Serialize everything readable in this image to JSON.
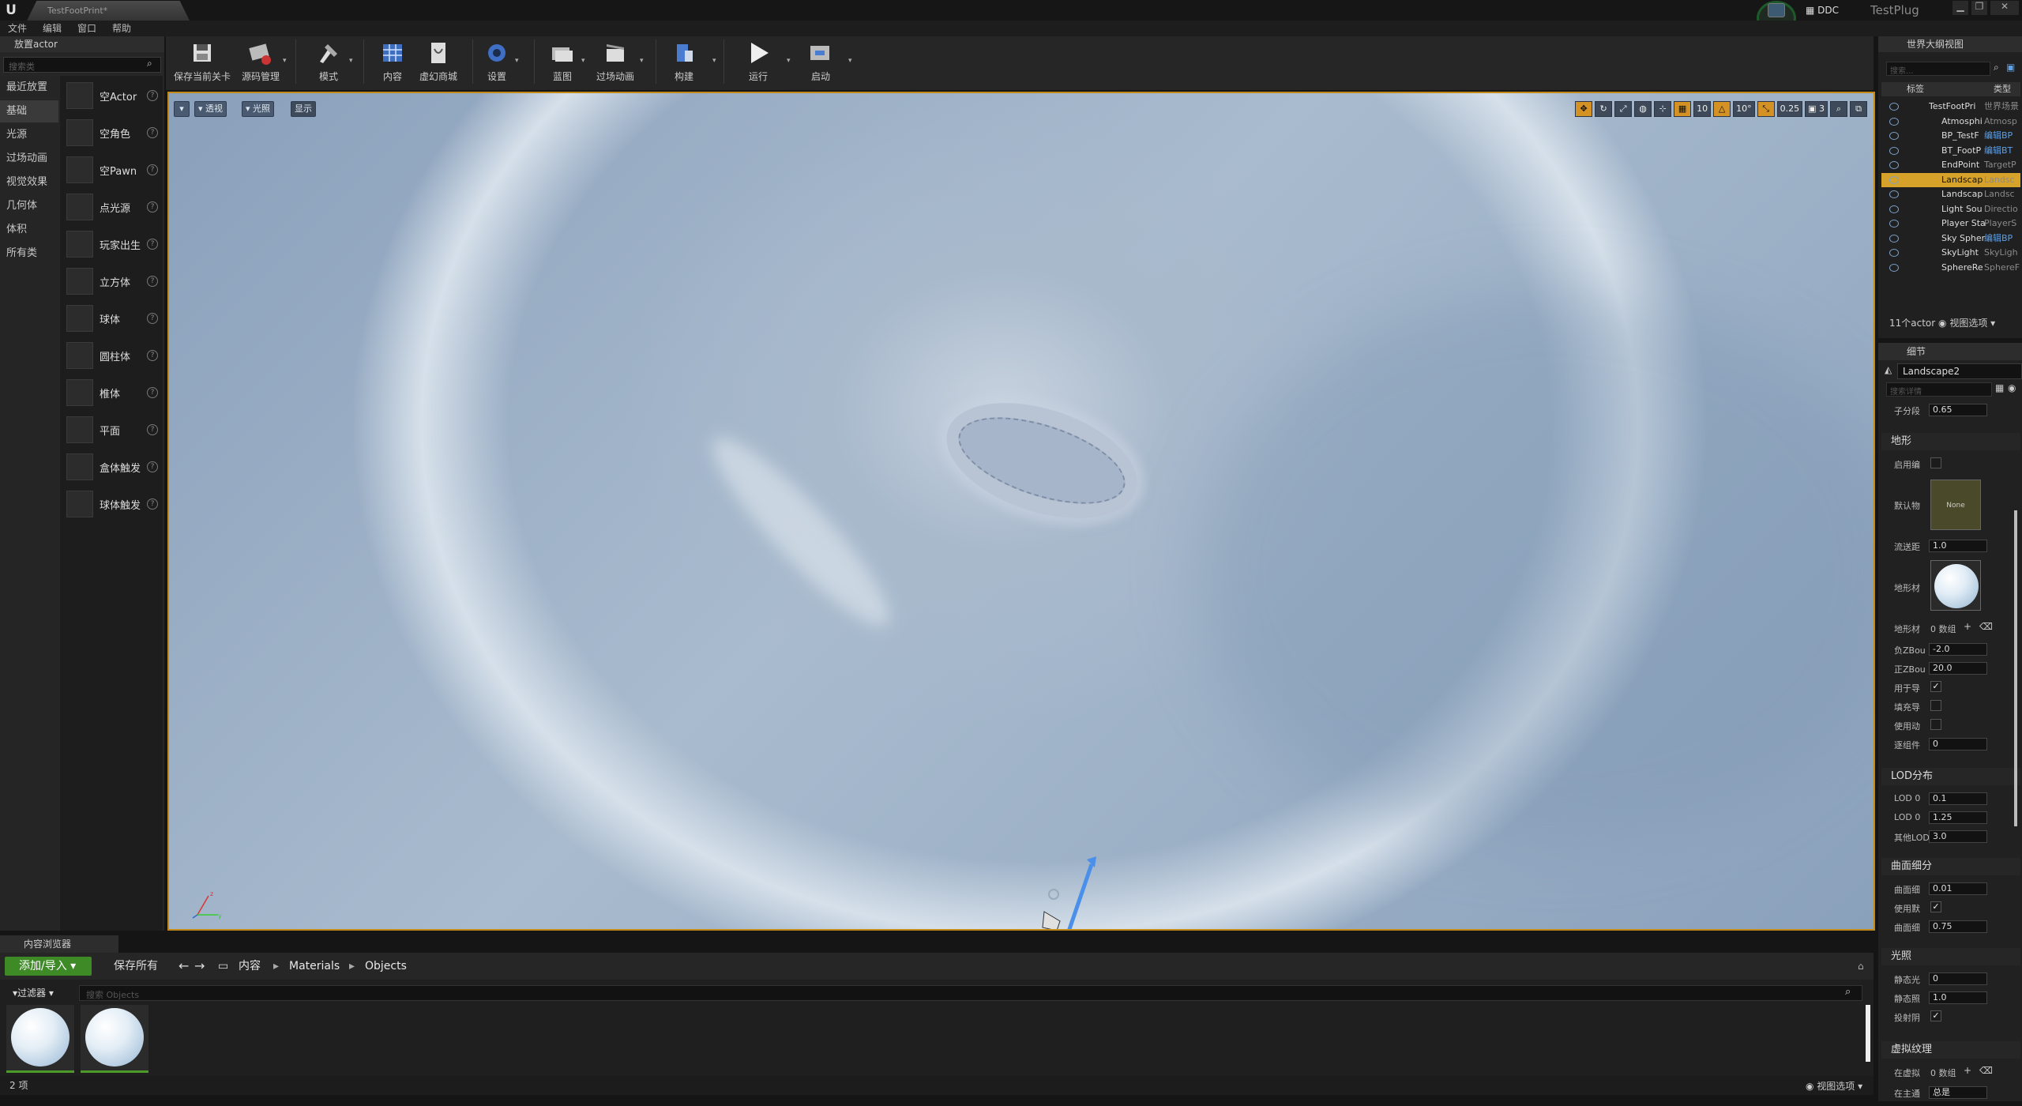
{
  "window": {
    "tab_title": "TestFootPrint*",
    "ddc_label": "DDC",
    "project_name": "TestPlug",
    "minimize": "▁",
    "maximize": "❐",
    "close": "✕"
  },
  "menu": [
    "文件",
    "编辑",
    "窗口",
    "帮助"
  ],
  "place_actors": {
    "tab_title": "放置actor",
    "search_placeholder": "搜索类",
    "categories": [
      "最近放置",
      "基础",
      "光源",
      "过场动画",
      "视觉效果",
      "几何体",
      "体积",
      "所有类"
    ],
    "selected_category": "基础",
    "items": [
      "空Actor",
      "空角色",
      "空Pawn",
      "点光源",
      "玩家出生",
      "立方体",
      "球体",
      "圆柱体",
      "椎体",
      "平面",
      "盒体触发",
      "球体触发"
    ]
  },
  "toolbar": [
    "保存当前关卡",
    "源码管理",
    "模式",
    "内容",
    "虚幻商城",
    "设置",
    "蓝图",
    "过场动画",
    "构建",
    "运行",
    "启动"
  ],
  "viewport": {
    "perspective_label": "透视",
    "lit_label": "光照",
    "show_label": "显示",
    "grid_snap": "10",
    "rotation_snap": "10°",
    "scale_snap": "0.25",
    "camera_speed": "3"
  },
  "content_browser": {
    "tab_title": "内容浏览器",
    "add_import": "添加/导入",
    "save_all": "保存所有",
    "breadcrumb": [
      "内容",
      "Materials",
      "Objects"
    ],
    "filter_label": "过滤器",
    "search_placeholder": "搜索 Objects",
    "item_count": "2 项",
    "view_options": "视图选项"
  },
  "outliner": {
    "tab_title": "世界大纲视图",
    "search_placeholder": "搜索...",
    "col_label": "标签",
    "col_type": "类型",
    "rows": [
      {
        "name": "TestFootPri",
        "type": "世界场景",
        "blue": false
      },
      {
        "name": "Atmosphi",
        "type": "Atmosp",
        "blue": false
      },
      {
        "name": "BP_TestF",
        "type": "编辑BP",
        "blue": true
      },
      {
        "name": "BT_FootP",
        "type": "编辑BT",
        "blue": true
      },
      {
        "name": "EndPoint",
        "type": "TargetP",
        "blue": false
      },
      {
        "name": "Landscap",
        "type": "Landsc",
        "blue": false
      },
      {
        "name": "Landscap",
        "type": "Landsc",
        "blue": false
      },
      {
        "name": "Light Sou",
        "type": "Directio",
        "blue": false
      },
      {
        "name": "Player Sta",
        "type": "PlayerS",
        "blue": false
      },
      {
        "name": "Sky Spher",
        "type": "编辑BP",
        "blue": true
      },
      {
        "name": "SkyLight",
        "type": "SkyLigh",
        "blue": false
      },
      {
        "name": "SphereRe",
        "type": "SphereF",
        "blue": false
      }
    ],
    "footer": "11个actor",
    "view_options": "视图选项"
  },
  "details": {
    "tab_title": "细节",
    "actor_name": "Landscape2",
    "search_placeholder": "搜索详情",
    "subdiv_label": "子分段",
    "subdiv_value": "0.65",
    "landscape_section": "地形",
    "enable_edit": "启用编",
    "default_phys": "默认物",
    "none_label": "None",
    "stream_label": "流送距",
    "stream_value": "1.0",
    "landscape_mat": "地形材",
    "mat_count_label": "地形材",
    "mat_count_value": "0 数组",
    "negz_label": "负ZBou",
    "negz_value": "-2.0",
    "posz_label": "正ZBou",
    "posz_value": "20.0",
    "nav_label": "用于导",
    "fill_label": "填充导",
    "dyn_label": "使用动",
    "comp_label": "逐组件",
    "comp_value": "0",
    "lod_section": "LOD分布",
    "lod0_label": "LOD 0",
    "lod0_value": "0.1",
    "lod0b_label": "LOD 0",
    "lod0b_value": "1.25",
    "lodo_label": "其他LOD",
    "lodo_value": "3.0",
    "tess_section": "曲面细分",
    "tess1_label": "曲面细",
    "tess1_value": "0.01",
    "tess2_label": "使用默",
    "tess3_label": "曲面细",
    "tess3_value": "0.75",
    "light_section": "光照",
    "light1_label": "静态光",
    "light1_value": "0",
    "light2_label": "静态照",
    "light2_value": "1.0",
    "light3_label": "投射阴",
    "vt_section": "虚拟纹理",
    "vt1_label": "在虚拟",
    "vt1_value": "0 数组",
    "vt2_label": "在主通",
    "vt2_value": "总是"
  }
}
